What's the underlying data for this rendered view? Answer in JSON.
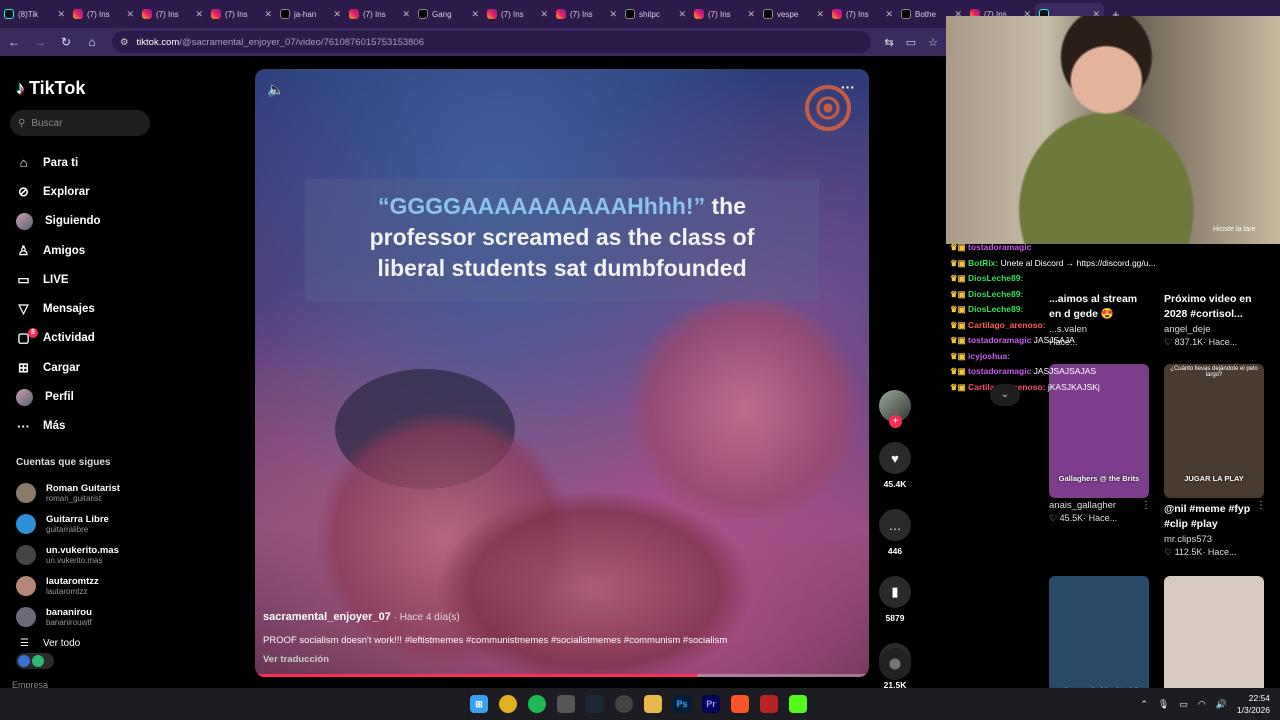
{
  "browser": {
    "tabs": [
      {
        "label": "(8)Tik",
        "icon": "tk"
      },
      {
        "label": "(7) Ins",
        "icon": "ig"
      },
      {
        "label": "(7) Ins",
        "icon": "ig"
      },
      {
        "label": "(7) Ins",
        "icon": "ig"
      },
      {
        "label": "ja-han",
        "icon": "x"
      },
      {
        "label": "(7) Ins",
        "icon": "ig"
      },
      {
        "label": "Gang",
        "icon": "x"
      },
      {
        "label": "(7) Ins",
        "icon": "ig"
      },
      {
        "label": "(7) Ins",
        "icon": "ig"
      },
      {
        "label": "shitpc",
        "icon": "x"
      },
      {
        "label": "(7) Ins",
        "icon": "ig"
      },
      {
        "label": "vespe",
        "icon": "x"
      },
      {
        "label": "(7) Ins",
        "icon": "ig"
      },
      {
        "label": "Bothe",
        "icon": "x"
      },
      {
        "label": "(7) Ins",
        "icon": "ig"
      },
      {
        "label": "",
        "icon": "tk"
      }
    ],
    "url_host": "tiktok.com",
    "url_path": "/@sacramental_enjoyer_07/video/7610876015753153806"
  },
  "sidebar": {
    "brand": "TikTok",
    "search_placeholder": "Buscar",
    "nav": [
      {
        "label": "Para ti",
        "icon": "home-icon",
        "glyph": "⌂"
      },
      {
        "label": "Explorar",
        "icon": "compass-icon",
        "glyph": "⊘"
      },
      {
        "label": "Siguiendo",
        "icon": "avatar-icon",
        "glyph": ""
      },
      {
        "label": "Amigos",
        "icon": "friends-icon",
        "glyph": "♙"
      },
      {
        "label": "LIVE",
        "icon": "live-icon",
        "glyph": "▭"
      },
      {
        "label": "Mensajes",
        "icon": "messages-icon",
        "glyph": "▽"
      },
      {
        "label": "Actividad",
        "icon": "activity-icon",
        "glyph": "▢",
        "badge": "8"
      },
      {
        "label": "Cargar",
        "icon": "upload-icon",
        "glyph": "⊞"
      },
      {
        "label": "Perfil",
        "icon": "profile-icon",
        "glyph": ""
      },
      {
        "label": "Más",
        "icon": "more-icon",
        "glyph": "···"
      }
    ],
    "following_title": "Cuentas que sigues",
    "following": [
      {
        "name": "Roman Guitarist",
        "user": "roman_guitarist"
      },
      {
        "name": "Guitarra Libre",
        "user": "guitarralibre"
      },
      {
        "name": "un.vukerito.mas",
        "user": "un.vukerito.mas"
      },
      {
        "name": "lautaromtzz",
        "user": "lautaromtzz"
      },
      {
        "name": "bananirou",
        "user": "bananirouwtf"
      }
    ],
    "see_all": "Ver todo",
    "business": "Empresa"
  },
  "video": {
    "caption_highlight": "“GGGGAAAAAAAAAAHhhh!”",
    "caption_rest_1": " the",
    "caption_line_2": "professor screamed as the class of",
    "caption_line_3": "liberal students sat dumbfounded",
    "author": "sacramental_enjoyer_07",
    "ago": " · Hace 4 día(s)",
    "description": "PROOF socialism doesn't work!!! #leftistmemes #communistmemes #socialistmemes #communism #socialism",
    "translate": "Ver traducción",
    "progress": 0.72
  },
  "actions": {
    "likes": "45.4K",
    "comments": "446",
    "saves": "5879",
    "shares": "21.5K"
  },
  "stream": {
    "webcam_overlay_text": "Hiciste la tare",
    "chat": [
      {
        "user": "tostadoramagic",
        "cls": "u1",
        "msg": ""
      },
      {
        "user": "BotRix:",
        "cls": "u2",
        "msg": " Unete al Discord → https://discord.gg/u..."
      },
      {
        "user": "DiosLeche89:",
        "cls": "u2",
        "msg": ""
      },
      {
        "user": "DiosLeche89:",
        "cls": "u2",
        "msg": ""
      },
      {
        "user": "DiosLeche89:",
        "cls": "u2",
        "msg": ""
      },
      {
        "user": "Cartilago_arenoso:",
        "cls": "u3",
        "msg": ""
      },
      {
        "user": "tostadoramagic",
        "cls": "u1",
        "msg": " JASJSAJA"
      },
      {
        "user": "icyjoshua:",
        "cls": "u1",
        "msg": ""
      },
      {
        "user": "tostadoramagic",
        "cls": "u1",
        "msg": " JASJSAJSAJAS"
      },
      {
        "user": "Cartilago_arenoso:",
        "cls": "u4",
        "msg": " jKASJKAJSKj"
      }
    ]
  },
  "grid": {
    "cards": [
      {
        "title": "...aimos al stream en d gede 😍",
        "user": "...s.valen",
        "meta": "",
        "time": "Hace...",
        "thumb": "",
        "bg": "#333"
      },
      {
        "title": "Próximo video en 2028 #cortisol...",
        "user": "angel_deje",
        "meta": "♡ 837.1K",
        "time": "· Hace...",
        "thumb": "",
        "bg": "#c8bfb3"
      },
      {
        "title": "",
        "user": "anais_gallagher",
        "meta": "♡ 45.5K",
        "time": "· Hace...",
        "thumb": "Gallaghers @ the Brits",
        "bg": "#7b3d8c"
      },
      {
        "title": "@nil #meme #fyp #clip #play",
        "user": "mr.clips573",
        "meta": "♡ 112.5K",
        "time": "· Hace...",
        "thumb": "JUGAR LA PLAY",
        "bg": "#4a3b30"
      },
      {
        "title": "",
        "user": "",
        "meta": "",
        "time": "",
        "thumb": "Yo siempre hablo de Idzi en",
        "bg": "#2a4a6a"
      },
      {
        "title": "",
        "user": "",
        "meta": "",
        "time": "",
        "thumb": "",
        "bg": "#d8c9c0"
      }
    ],
    "thumb_top_text": "¿Cuánto llevas dejándote el pelo largo?"
  },
  "taskbar": {
    "time": "22:54",
    "date": "1/3/2026"
  }
}
